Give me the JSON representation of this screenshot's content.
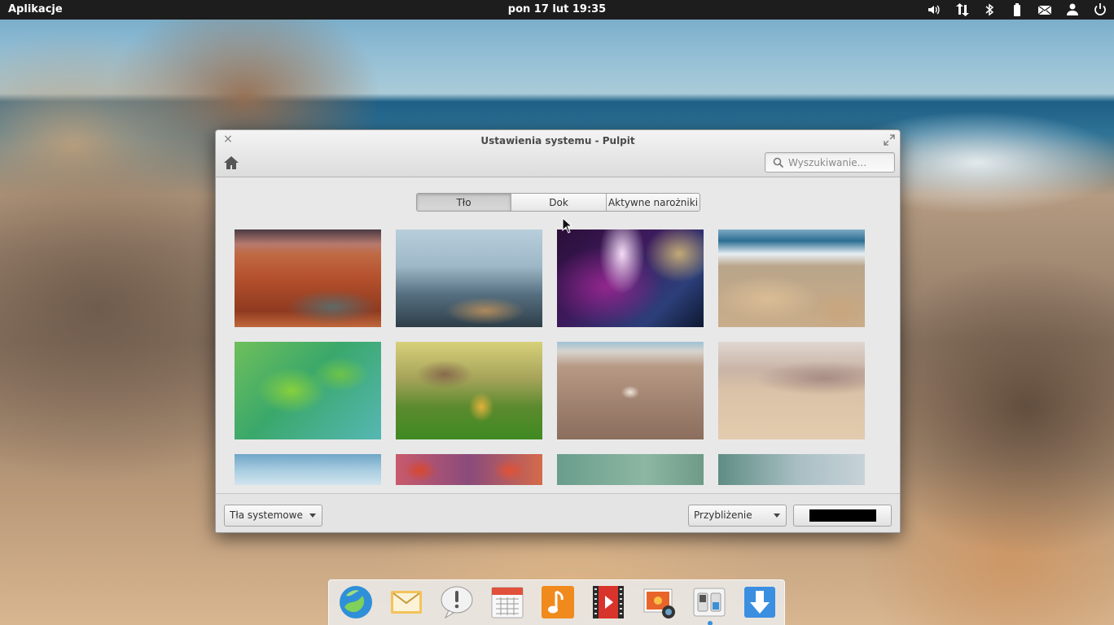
{
  "top_panel": {
    "apps_label": "Aplikacje",
    "clock": "pon 17 lut 19:35",
    "indicators": [
      "volume-icon",
      "network-icon",
      "bluetooth-icon",
      "battery-icon",
      "mail-icon",
      "user-icon",
      "power-icon"
    ]
  },
  "window": {
    "title": "Ustawienia systemu - Pulpit",
    "search_placeholder": "Wyszukiwanie...",
    "tabs": [
      {
        "label": "Tło",
        "active": true
      },
      {
        "label": "Dok",
        "active": false
      },
      {
        "label": "Aktywne narożniki",
        "active": false
      }
    ],
    "wallpapers": [
      "canyon",
      "winter-city",
      "cosmic-nebula",
      "sea-rocks",
      "green-leaves",
      "autumn-leaf-grass",
      "seashell-sand",
      "desert-dunes",
      "sky",
      "red-maple",
      "teal-blur",
      "grey-blur"
    ],
    "bottom": {
      "source_combo": "Tła systemowe",
      "zoom_combo": "Przybliżenie",
      "color_value": "#000000"
    }
  },
  "dock": {
    "items": [
      "browser",
      "mail",
      "feedback",
      "calendar",
      "music",
      "video",
      "photos",
      "system-settings",
      "app-center"
    ],
    "accent": "#3a90d8"
  }
}
